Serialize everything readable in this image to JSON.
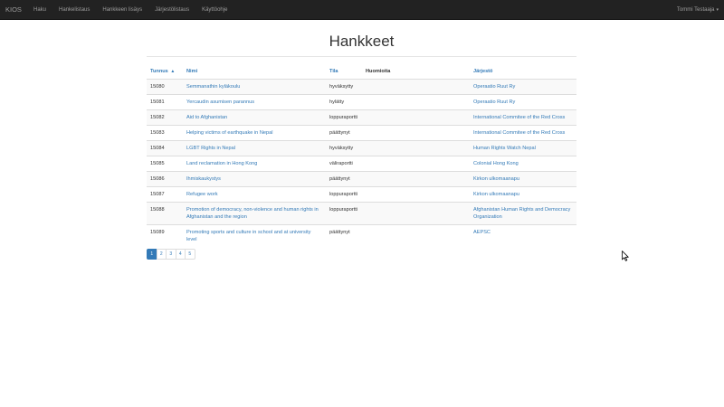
{
  "navbar": {
    "brand": "KIOS",
    "links": [
      "Haku",
      "Hankelistaus",
      "Hankkeen lisäys",
      "Järjestölistaus",
      "Käyttöohje"
    ],
    "user": "Tommi Testaaja",
    "user_caret": "▾"
  },
  "page": {
    "title": "Hankkeet"
  },
  "table": {
    "headers": {
      "id": "Tunnus",
      "id_sort": "▲",
      "name": "Nimi",
      "status": "Tila",
      "notes": "Huomioita",
      "org": "Järjestö"
    },
    "rows": [
      {
        "id": "15080",
        "name": "Semmanathin kyläkoulu",
        "status": "hyväksytty",
        "notes": "",
        "org": "Operaatio Ruut Ry"
      },
      {
        "id": "15081",
        "name": "Yercaudin asumisen parannus",
        "status": "hylätty",
        "notes": "",
        "org": "Operaatio Ruut Ry"
      },
      {
        "id": "15082",
        "name": "Aid to Afghanistan",
        "status": "loppuraportti",
        "notes": "",
        "org": "International Commitee of the Red Cross"
      },
      {
        "id": "15083",
        "name": "Helping victims of earthquake in Nepal",
        "status": "päättynyt",
        "notes": "",
        "org": "International Commitee of the Red Cross"
      },
      {
        "id": "15084",
        "name": "LGBT Rights in Nepal",
        "status": "hyväksytty",
        "notes": "",
        "org": "Human Rights Watch Nepal"
      },
      {
        "id": "15085",
        "name": "Land reclamation in Hong Kong",
        "status": "väliraportti",
        "notes": "",
        "org": "Colonial Hong Kong"
      },
      {
        "id": "15086",
        "name": "Ihmiskaukystys",
        "status": "päättynyt",
        "notes": "",
        "org": "Kirkon ulkomaanapu"
      },
      {
        "id": "15087",
        "name": "Refugee work",
        "status": "loppuraportti",
        "notes": "",
        "org": "Kirkon ulkomaanapu"
      },
      {
        "id": "15088",
        "name": "Promotion of democracy, non-violence and human rights in Afghanistan and the region",
        "status": "loppuraportti",
        "notes": "",
        "org": "Afghanistan Human Rights and Democracy Organization"
      },
      {
        "id": "15089",
        "name": "Promoting sports and culture in school and at university level",
        "status": "päättynyt",
        "notes": "",
        "org": "AEPSC"
      }
    ]
  },
  "pagination": {
    "pages": [
      "1",
      "2",
      "3",
      "4",
      "5"
    ],
    "active": "1"
  },
  "colors": {
    "navbar_bg": "#222222",
    "link": "#337ab7",
    "active_page": "#337ab7"
  }
}
